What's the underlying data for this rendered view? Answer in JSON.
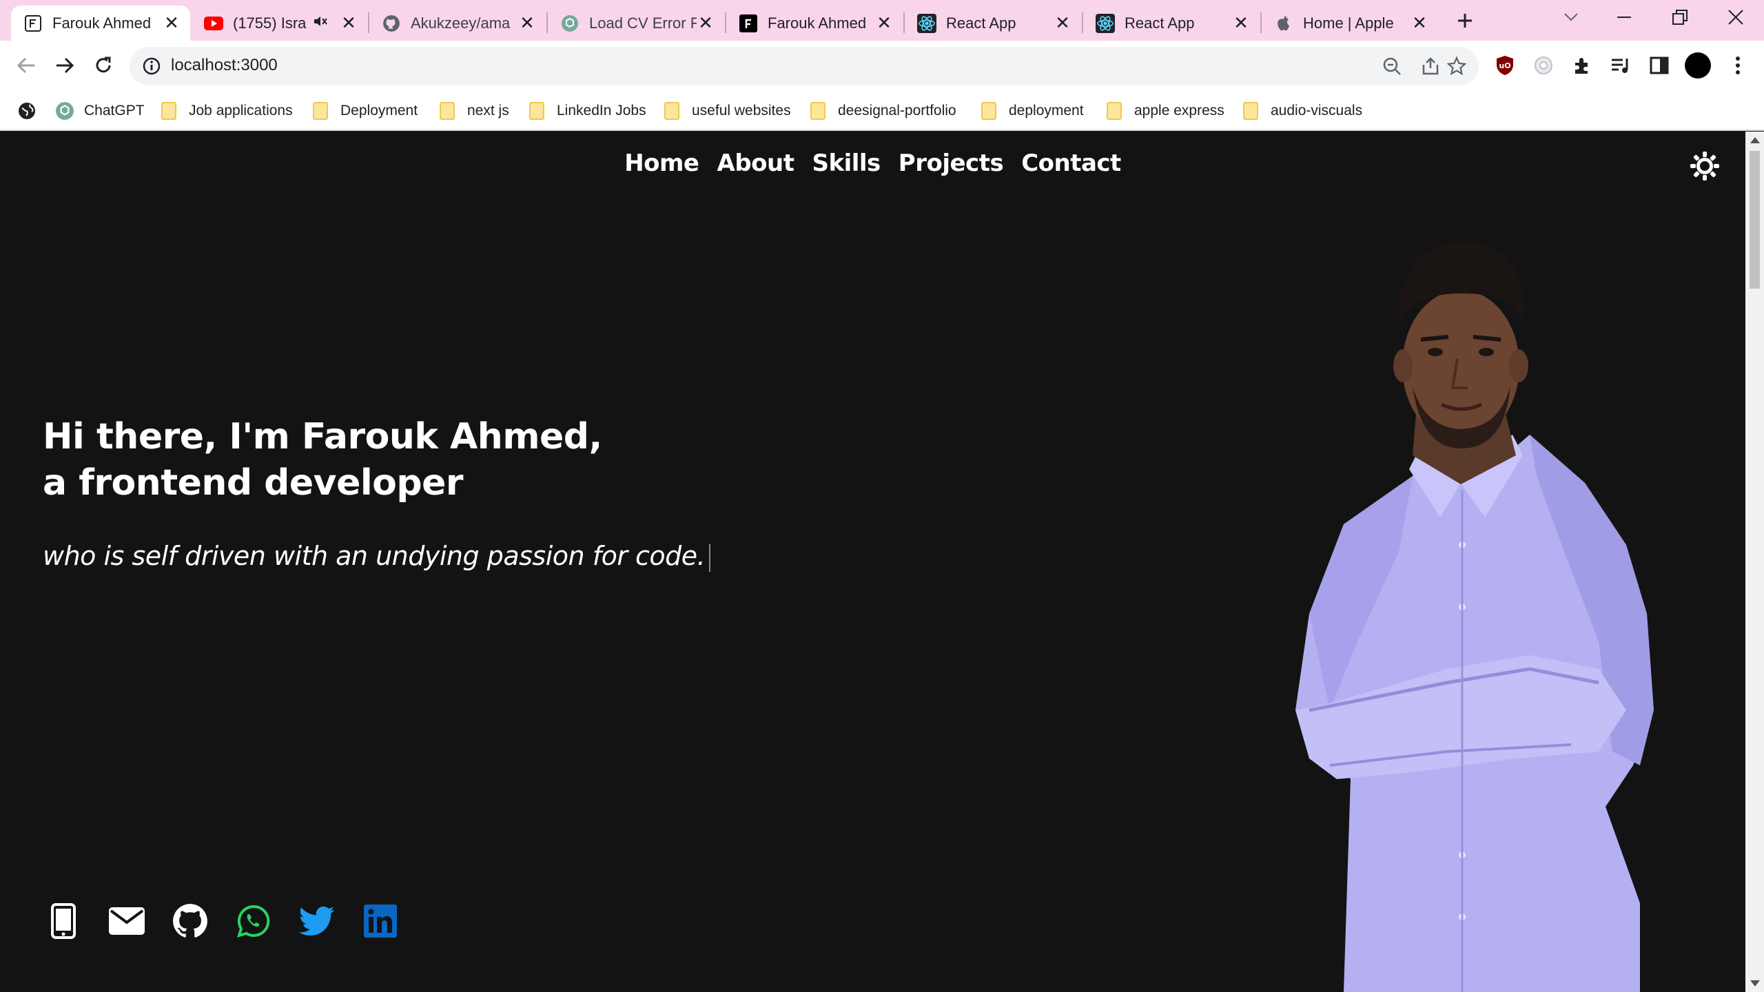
{
  "browser": {
    "tabs": [
      {
        "title": "Farouk Ahmed",
        "icon": "framer-f-icon",
        "active": true
      },
      {
        "title": "(1755) Isra",
        "icon": "youtube-icon",
        "audio": true
      },
      {
        "title": "Akukzeey/ama",
        "icon": "github-icon"
      },
      {
        "title": "Load CV Error F",
        "icon": "chatgpt-icon"
      },
      {
        "title": "Farouk Ahmed",
        "icon": "framer-f-icon"
      },
      {
        "title": "React App",
        "icon": "react-icon"
      },
      {
        "title": "React App",
        "icon": "react-icon"
      },
      {
        "title": "Home | Apple",
        "icon": "apple-icon"
      }
    ],
    "close_glyph": "✕",
    "new_tab_glyph": "+",
    "url": "localhost:3000",
    "bookmarks": [
      {
        "label": "ChatGPT",
        "type": "chatgpt"
      },
      {
        "label": "Job applications",
        "type": "folder"
      },
      {
        "label": "Deployment",
        "type": "folder"
      },
      {
        "label": "next js",
        "type": "folder"
      },
      {
        "label": "LinkedIn Jobs",
        "type": "folder"
      },
      {
        "label": "useful websites",
        "type": "folder"
      },
      {
        "label": "deesignal-portfolio",
        "type": "folder"
      },
      {
        "label": "deployment",
        "type": "folder"
      },
      {
        "label": "apple express",
        "type": "folder"
      },
      {
        "label": "audio-viscuals",
        "type": "folder"
      }
    ],
    "tabstrip_color": "#f9d5ea"
  },
  "site": {
    "nav": [
      "Home",
      "About",
      "Skills",
      "Projects",
      "Contact"
    ],
    "hero": {
      "line1": "Hi there, I'm Farouk Ahmed,",
      "line2": "a frontend developer",
      "subtitle": "who is self driven with an undying passion for code."
    },
    "socials": [
      {
        "name": "phone-icon",
        "color": "#ffffff"
      },
      {
        "name": "email-icon",
        "color": "#ffffff"
      },
      {
        "name": "github-icon",
        "color": "#ffffff"
      },
      {
        "name": "whatsapp-icon",
        "color": "#25d366"
      },
      {
        "name": "twitter-icon",
        "color": "#1d9bf0"
      },
      {
        "name": "linkedin-icon",
        "color": "#0a66c2"
      }
    ],
    "background": "#131313",
    "text_color": "#ffffff"
  }
}
